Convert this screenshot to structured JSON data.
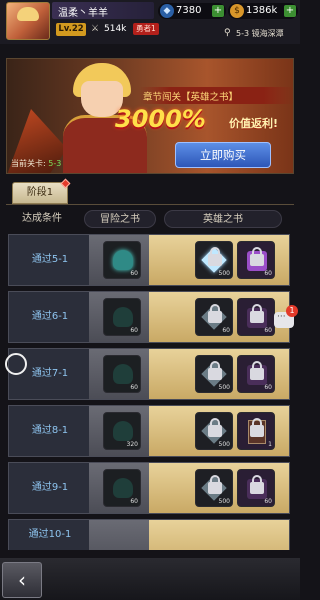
{
  "player": {
    "name": "温柔丶羊羊",
    "level": "Lv.22",
    "power_icon": "crossed-swords-icon",
    "power": "514k",
    "rank": "勇者1"
  },
  "resources": {
    "gems": {
      "icon": "gem-icon",
      "value": "7380",
      "plus": "+"
    },
    "gold": {
      "icon": "coin-icon",
      "value": "1386k",
      "plus": "+"
    }
  },
  "location": {
    "icon": "map-pin-icon",
    "text": "5-3  镜海深潭"
  },
  "banner": {
    "title": "章节闯关【英雄之书】",
    "big": "3000%",
    "sub": "价值返利!",
    "buy_label": "立即购买",
    "current_label": "当前关卡:",
    "current_value": "5-3"
  },
  "stage_tab": {
    "label": "阶段1"
  },
  "columns": {
    "condition": "达成条件",
    "adventure": "冒险之书",
    "hero": "英雄之书"
  },
  "rows": [
    {
      "label": "通过5-1",
      "adv_count": "60",
      "item1_count": "500",
      "item2_count": "60",
      "unlocked": true
    },
    {
      "label": "通过6-1",
      "adv_count": "60",
      "item1_count": "60",
      "item2_count": "60",
      "unlocked": false
    },
    {
      "label": "通过7-1",
      "adv_count": "60",
      "item1_count": "500",
      "item2_count": "60",
      "unlocked": false
    },
    {
      "label": "通过8-1",
      "adv_count": "320",
      "item1_count": "500",
      "item2_count": "1",
      "unlocked": false
    },
    {
      "label": "通过9-1",
      "adv_count": "60",
      "item1_count": "500",
      "item2_count": "60",
      "unlocked": false
    },
    {
      "label": "通过10-1",
      "adv_count": "",
      "item1_count": "",
      "item2_count": "",
      "unlocked": false
    }
  ],
  "chat": {
    "icon": "chat-icon",
    "badge": "1"
  },
  "back": {
    "icon": "back-arrow-icon",
    "glyph": "‹"
  }
}
